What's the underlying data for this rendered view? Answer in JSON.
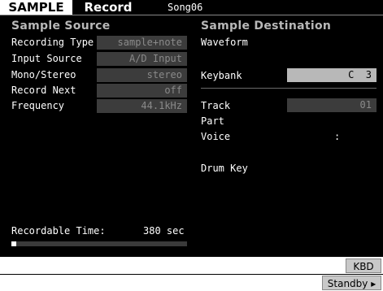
{
  "header": {
    "mode_tab": "SAMPLE",
    "page_tab": "Record",
    "song": "Song06"
  },
  "sample_source": {
    "title": "Sample Source",
    "recording_type": {
      "label": "Recording Type",
      "value": "sample+note"
    },
    "input_source": {
      "label": "Input Source",
      "value": "A/D Input"
    },
    "mono_stereo": {
      "label": "Mono/Stereo",
      "value": "stereo"
    },
    "record_next": {
      "label": "Record Next",
      "value": "off"
    },
    "frequency": {
      "label": "Frequency",
      "value": "44.1kHz"
    }
  },
  "sample_destination": {
    "title": "Sample Destination",
    "waveform_label": "Waveform",
    "keybank": {
      "label": "Keybank",
      "value": "C  3"
    },
    "track": {
      "label": "Track",
      "value": "01"
    },
    "part_label": "Part",
    "voice": {
      "label": "Voice",
      "value": ":"
    },
    "drum_key_label": "Drum Key"
  },
  "recordable": {
    "label": "Recordable Time:",
    "value": "380 sec",
    "progress": 0.03
  },
  "softkeys": {
    "kbd": "KBD",
    "standby": "Standby ▸"
  }
}
